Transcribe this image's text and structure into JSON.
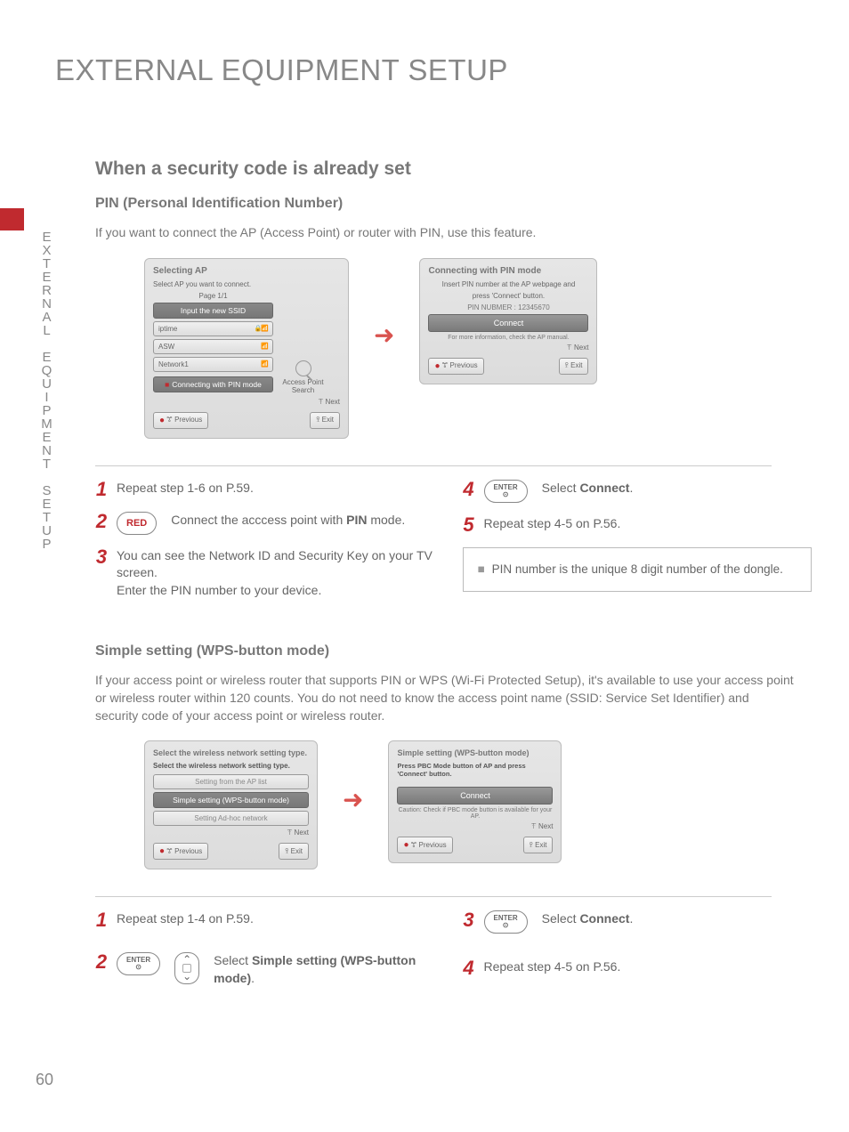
{
  "page_number": "60",
  "side_title": "EXTERNAL EQUIPMENT SETUP",
  "h1": "EXTERNAL EQUIPMENT SETUP",
  "sec1": {
    "h2": "When a security code is already set",
    "h3": "PIN (Personal Identification Number)",
    "intro": "If you want to connect the AP (Access Point) or router with PIN, use this feature.",
    "panelA": {
      "title": "Selecting AP",
      "sub": "Select AP you want to connect.",
      "page": "Page 1/1",
      "input": "Input the new SSID",
      "items": [
        "iptime",
        "ASW",
        "Network1"
      ],
      "pinmode": "Connecting with PIN mode",
      "search": "Access Point Search",
      "next": "ꔉ Next",
      "prev": "ꔅ Previous",
      "exit": "ꕉ Exit"
    },
    "panelB": {
      "title": "Connecting with PIN mode",
      "sub1": "Insert PIN number at the AP webpage and",
      "sub2": "press 'Connect' button.",
      "pin": "PIN NUBMER : 12345670",
      "connect": "Connect",
      "note": "For more information, check the AP manual.",
      "next": "ꔉ Next",
      "prev": "ꔅ Previous",
      "exit": "ꕉ Exit"
    },
    "steps": {
      "s1": "Repeat step 1-6 on P.59.",
      "s2a": "Connect the acccess point with ",
      "s2b": "PIN",
      "s2c": " mode.",
      "s2btn": "RED",
      "s3a": "You can see the Network ID and Security Key on your TV screen.",
      "s3b": "Enter the PIN number to your device.",
      "s4btn": "ENTER",
      "s4a": "Select ",
      "s4b": "Connect",
      "s4c": ".",
      "s5": "Repeat step 4-5 on P.56.",
      "infobox": "PIN number is the unique 8 digit number of the dongle."
    }
  },
  "sec2": {
    "h3": "Simple setting (WPS-button mode)",
    "intro": "If your access point or wireless router that supports PIN or WPS (Wi-Fi Protected Setup), it's available to use your access point or wireless router within 120 counts. You do not need to know the access point name (SSID: Service Set Identifier) and security code of your access point or wireless router.",
    "panelA": {
      "title": "Select the wireless network setting type.",
      "sub": "Select the wireless network setting type.",
      "opt1": "Setting from the AP list",
      "opt2": "Simple setting (WPS-button mode)",
      "opt3": "Setting Ad-hoc network",
      "next": "ꔉ Next",
      "prev": "ꔅ Previous",
      "exit": "ꕉ Exit"
    },
    "panelB": {
      "title": "Simple setting (WPS-button mode)",
      "sub": "Press PBC Mode button of AP and press 'Connect' button.",
      "connect": "Connect",
      "note": "Caution: Check if PBC mode button is available for your AP.",
      "next": "ꔉ Next",
      "prev": "ꔅ Previous",
      "exit": "ꕉ Exit"
    },
    "steps": {
      "s1": "Repeat step 1-4 on P.59.",
      "s2btn1": "ENTER",
      "s2a": "Select ",
      "s2b": "Simple setting (WPS-button mode)",
      "s2c": ".",
      "s3btn": "ENTER",
      "s3a": "Select ",
      "s3b": "Connect",
      "s3c": ".",
      "s4": "Repeat step 4-5 on P.56."
    }
  }
}
